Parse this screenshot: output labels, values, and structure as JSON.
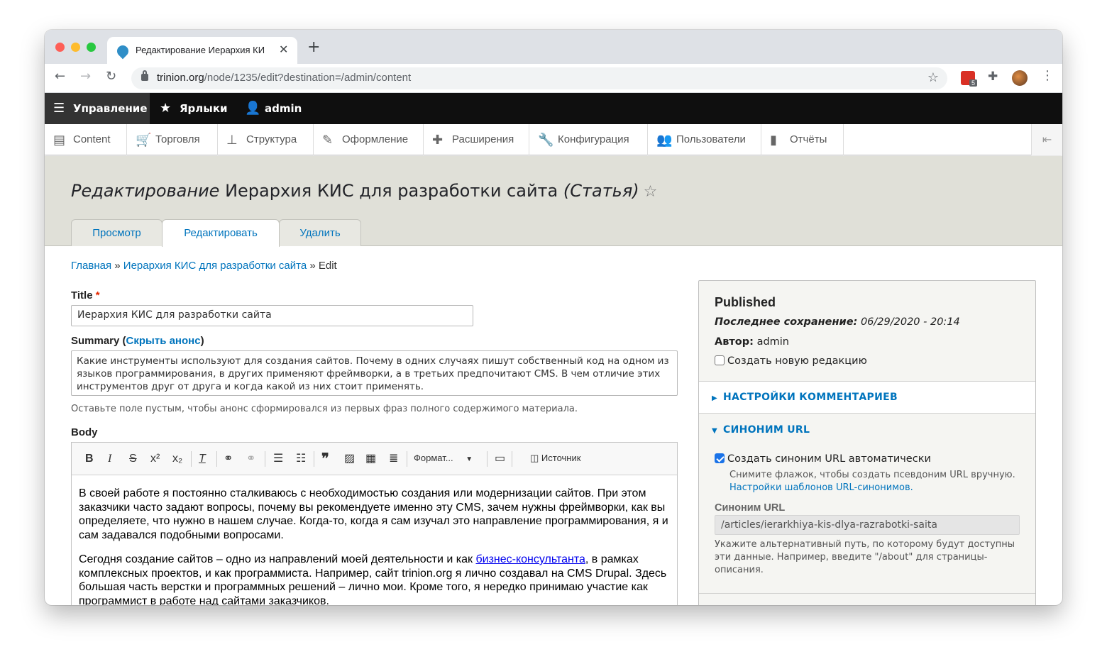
{
  "browser": {
    "tab_title": "Редактирование Иерархия КИ",
    "tab_close": "✕",
    "new_tab": "+",
    "url_host": "trinion.org",
    "url_path": "/node/1235/edit?destination=/admin/content",
    "ext_badge": "5"
  },
  "adminbar": {
    "manage": "Управление",
    "shortcuts": "Ярлыки",
    "user": "admin"
  },
  "tray": {
    "items": [
      "Content",
      "Торговля",
      "Структура",
      "Оформление",
      "Расширения",
      "Конфигурация",
      "Пользователи",
      "Отчёты"
    ]
  },
  "page": {
    "title_prefix": "Редактирование",
    "title_main": "Иерархия КИС для разработки сайта",
    "title_suffix": "(Статья)",
    "tabs": [
      "Просмотр",
      "Редактировать",
      "Удалить"
    ],
    "active_tab": "Редактировать"
  },
  "breadcrumb": {
    "home": "Главная",
    "sep1": "»",
    "node": "Иерархия КИС для разработки сайта",
    "sep2": "»",
    "current": "Edit"
  },
  "form": {
    "title_label": "Title",
    "title_required": "*",
    "title_value": "Иерархия КИС для разработки сайта",
    "summary_label": "Summary",
    "summary_toggle": "Скрыть анонс",
    "summary_value": "Какие инструменты используют для создания сайтов. Почему в одних случаях пишут собственный код на одном из языков программирования, в других применяют фреймворки, а в третьих предпочитают CMS. В чем отличие этих инструментов друг от друга и когда какой из них стоит применять.",
    "summary_description": "Оставьте поле пустым, чтобы анонс сформировался из первых фраз полного содержимого материала.",
    "body_label": "Body",
    "editor_format": "Формат...",
    "editor_source": "Источник",
    "body_p1": "В своей работе я постоянно сталкиваюсь с необходимостью создания или модернизации сайтов. При этом заказчики часто задают вопросы, почему вы рекомендуете именно эту CMS, зачем нужны фреймворки, как вы определяете, что нужно в нашем случае. Когда-то, когда я сам изучал это направление программирования, я и сам задавался подобными вопросами.",
    "body_p2_start": "Сегодня создание сайтов – одно из направлений моей деятельности и как ",
    "body_p2_link": "бизнес-консультанта",
    "body_p2_end": ", в рамках комплексных проектов, и как программиста. Например, сайт trinion.org я лично создавал на CMS Drupal. Здесь большая часть верстки и программных решений – лично мои. Кроме того, я нередко принимаю участие как программист в работе над сайтами заказчиков."
  },
  "sidebar": {
    "status": "Published",
    "last_saved_label": "Последнее сохранение:",
    "last_saved_value": "06/29/2020 - 20:14",
    "author_label": "Автор:",
    "author_value": "admin",
    "new_revision": "Создать новую редакцию",
    "comments_title": "НАСТРОЙКИ КОММЕНТАРИЕВ",
    "url_alias_title": "СИНОНИМ URL",
    "auto_alias": "Создать синоним URL автоматически",
    "auto_alias_desc": "Снимите флажок, чтобы создать псевдоним URL вручную.",
    "pattern_link": "Настройки шаблонов URL-синонимов.",
    "alias_label": "Синоним URL",
    "alias_value": "/articles/ierarkhiya-kis-dlya-razrabotki-saita",
    "alias_desc": "Укажите альтернативный путь, по которому будут доступны эти данные. Например, введите \"/about\" для страницы-описания."
  }
}
